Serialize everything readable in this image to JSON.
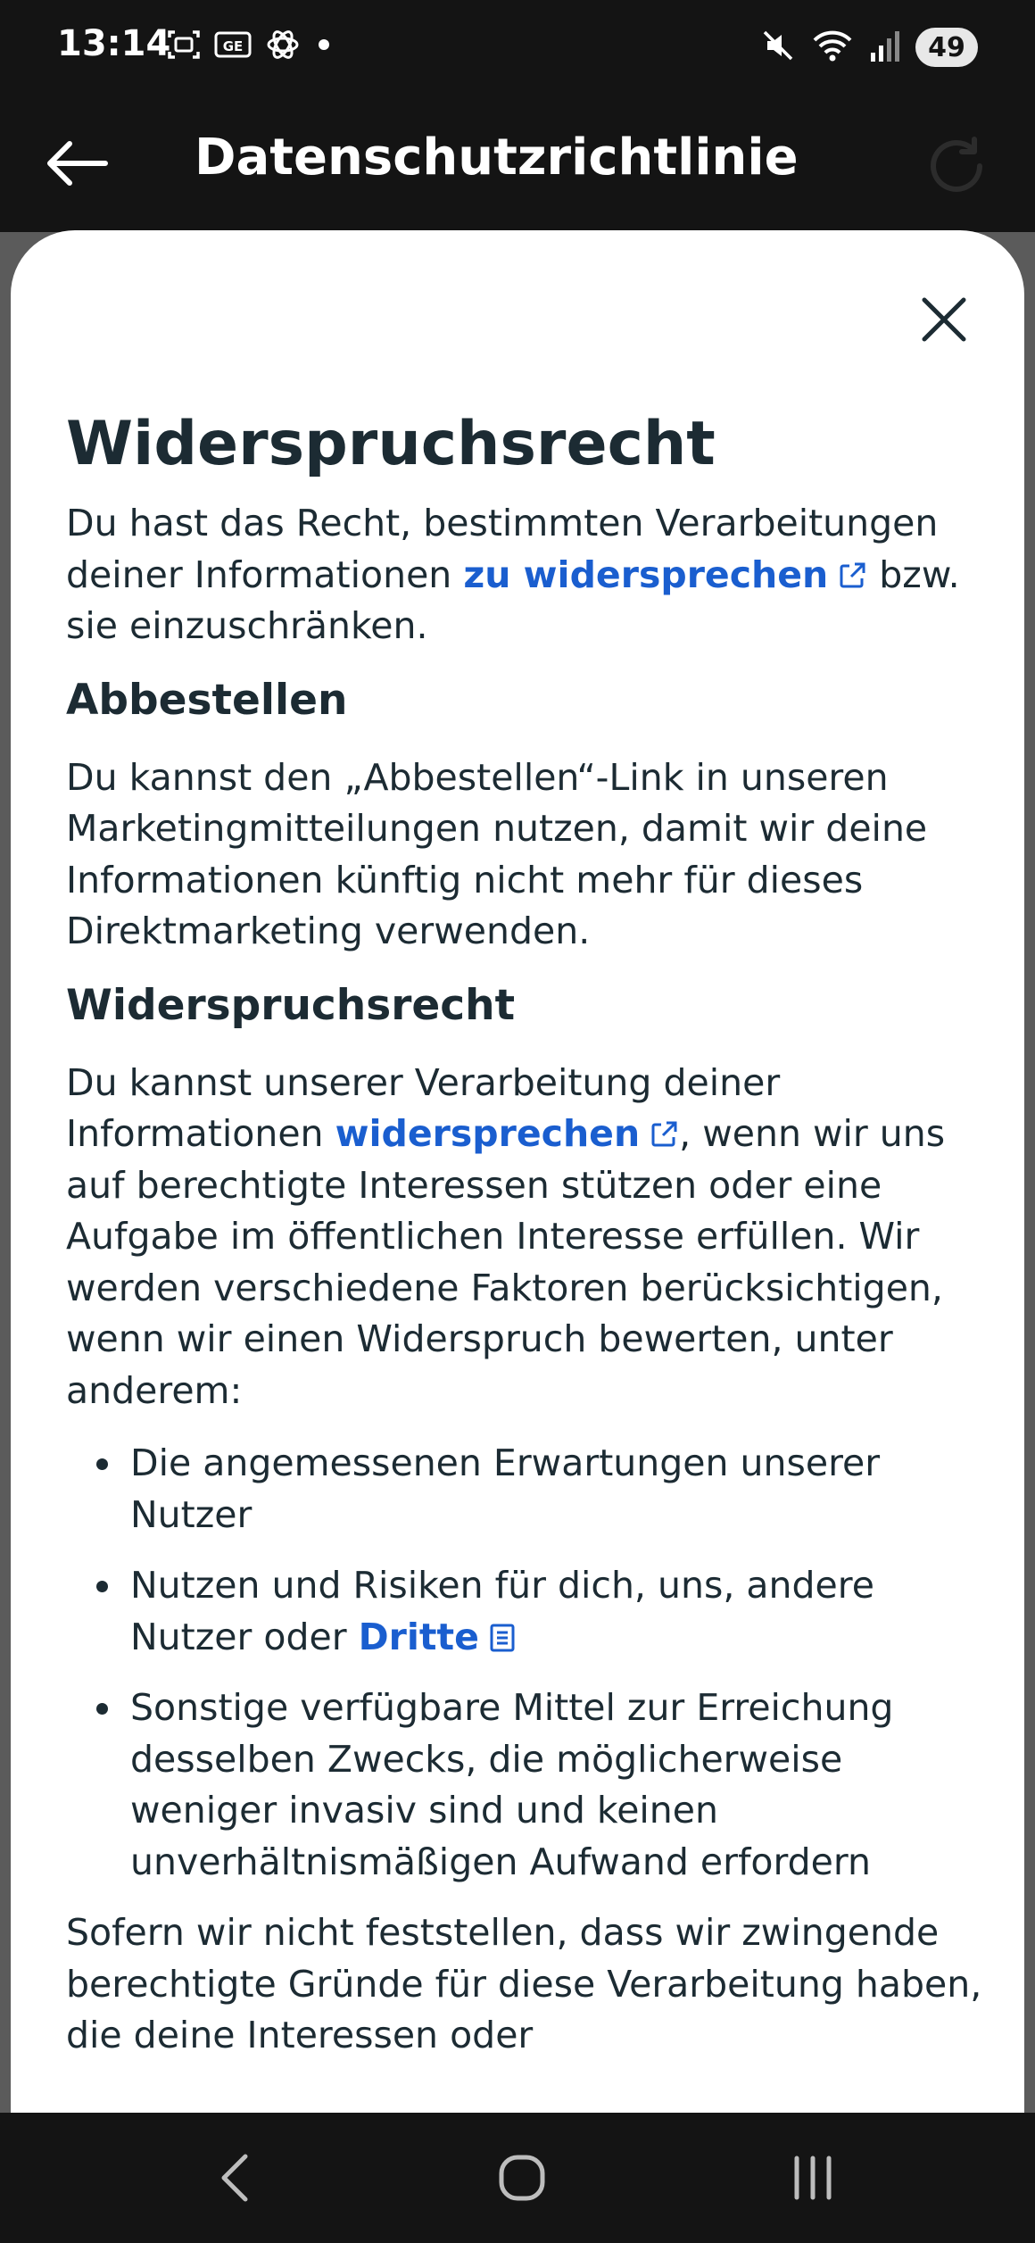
{
  "status_bar": {
    "time": "13:14",
    "battery": "49",
    "icons_left": [
      "screenshot-icon",
      "ge-icon",
      "chatgpt-icon",
      "dot-icon"
    ],
    "icons_right": [
      "mute-icon",
      "wifi-icon",
      "signal-icon",
      "battery-icon"
    ]
  },
  "app_bar": {
    "title": "Datenschutzrichtlinie"
  },
  "sheet": {
    "heading": "Widerspruchsrecht",
    "intro_text_1": "Du hast das Recht, bestimmten Verarbeitungen deiner Informationen ",
    "intro_link": "zu widersprechen",
    "intro_text_2": " bzw. sie einzuschränken.",
    "section1_title": "Abbestellen",
    "section1_text": "Du kannst den „Abbestellen“-Link in unseren Marketingmitteilungen nutzen, damit wir deine Informationen künftig nicht mehr für dieses Direktmarketing verwenden.",
    "section2_title": "Widerspruchsrecht",
    "section2_text_1": "Du kannst unserer Verarbeitung deiner Informationen ",
    "section2_link": "widersprechen",
    "section2_text_2": ", wenn wir uns auf berechtigte Interessen stützen oder eine Aufgabe im öffentlichen Interesse erfüllen. Wir werden verschiedene Faktoren berücksichtigen, wenn wir einen Widerspruch bewerten, unter anderem:",
    "bullet1": "Die angemessenen Erwartungen unserer Nutzer",
    "bullet2_text": "Nutzen und Risiken für dich, uns, andere Nutzer oder ",
    "bullet2_link": "Dritte",
    "bullet3": "Sonstige verfügbare Mittel zur Erreichung desselben Zwecks, die möglicherweise weniger invasiv sind und keinen unverhältnismäßigen Aufwand erfordern",
    "closing_text": "Sofern wir nicht feststellen, dass wir zwingende berechtigte Gründe für diese Verarbeitung haben, die deine Interessen oder"
  },
  "colors": {
    "link": "#1a5ecf",
    "text": "#1c2b33",
    "bar_background": "#141414",
    "scrim": "#5b5b5b"
  }
}
